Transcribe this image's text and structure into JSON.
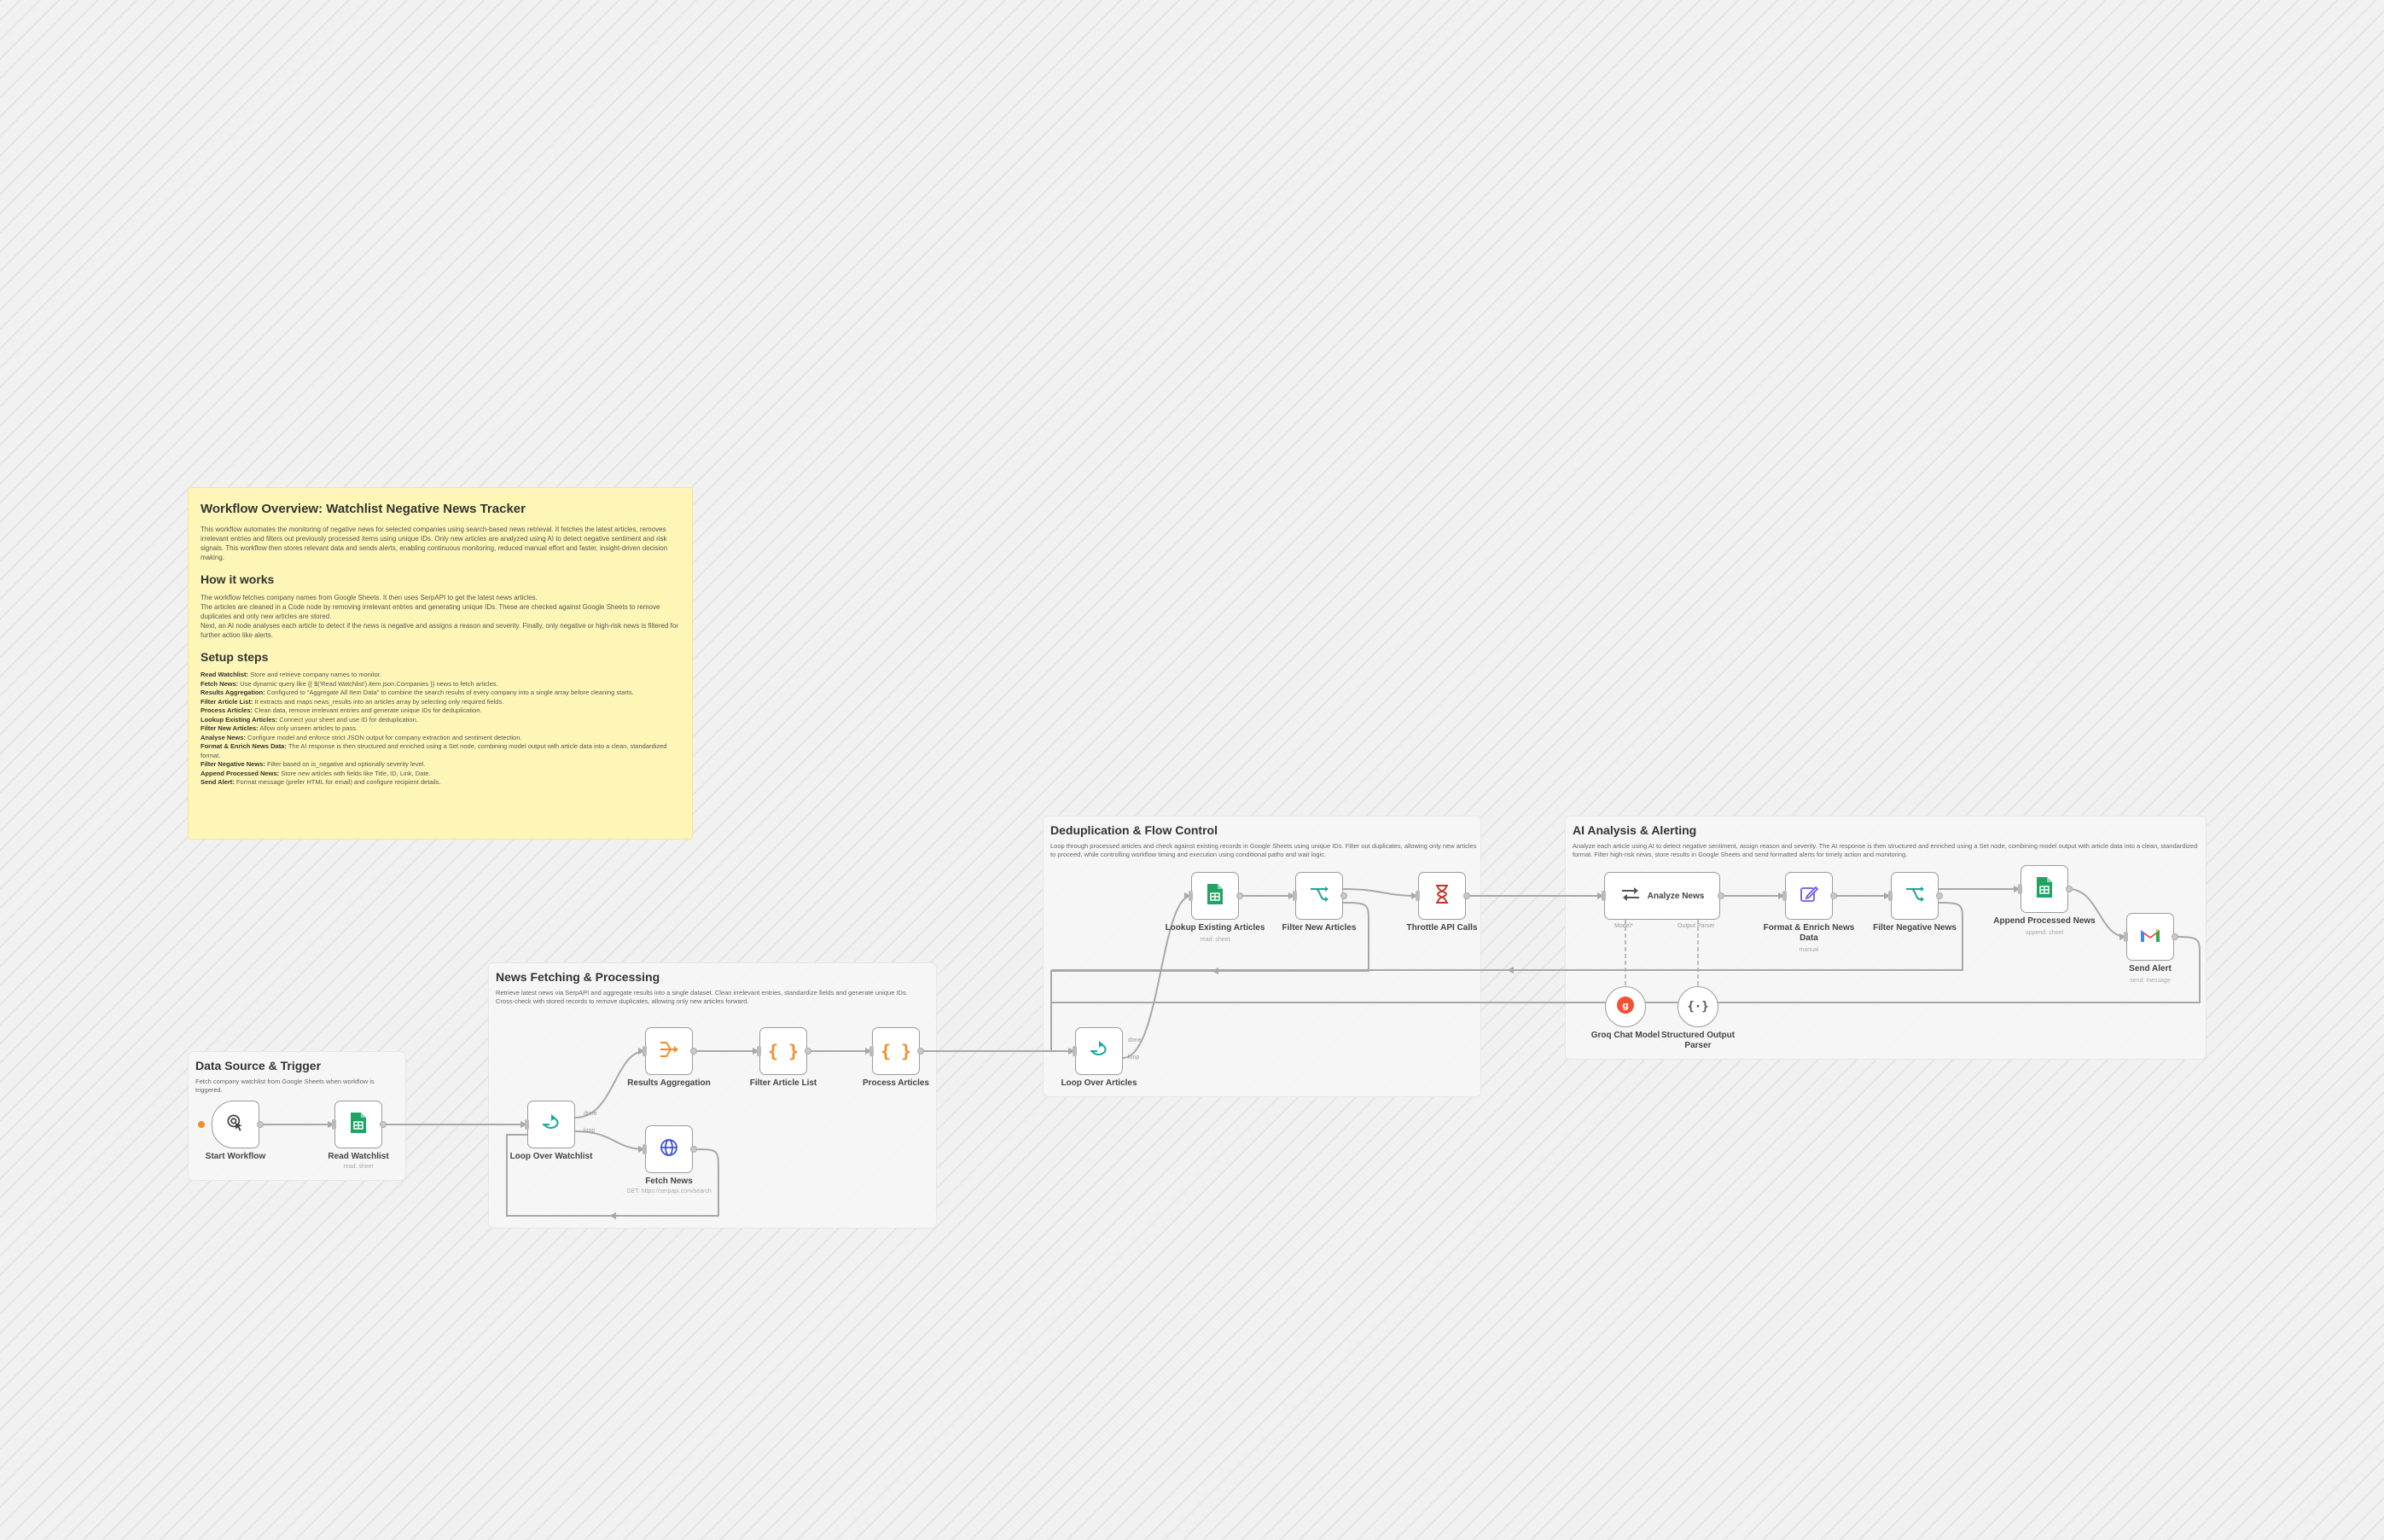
{
  "overview": {
    "title": "Workflow Overview: Watchlist Negative News Tracker",
    "intro": "This workflow automates the monitoring of negative news for selected companies using search-based news retrieval. It fetches the latest articles, removes irrelevant entries and filters out previously processed items using unique IDs. Only new articles are analyzed using AI to detect negative sentiment and risk signals. This workflow then stores relevant data and sends alerts, enabling continuous monitoring, reduced manual effort and faster, insight-driven decision making.",
    "how_title": "How it works",
    "how_1": "The workflow fetches company names from Google Sheets. It then uses SerpAPI to get the latest news articles.",
    "how_2": "The articles are cleaned in a Code node by removing irrelevant entries and generating unique IDs. These are checked against Google Sheets to remove duplicates and only new articles are stored.",
    "how_3": "Next, an AI node analyses each article to detect if the news is negative and assigns a reason and severity. Finally, only negative or high-risk news is filtered for further action like alerts.",
    "setup_title": "Setup steps",
    "steps": [
      {
        "name": "Read Watchlist:",
        "text": "Store and retrieve company names to monitor."
      },
      {
        "name": "Fetch News:",
        "text": "Use dynamic query like {{ $('Read Watchlist').item.json.Companies }} news to fetch articles."
      },
      {
        "name": "Results Aggregation:",
        "text": "Configured to \"Aggregate All Item Data\" to combine the search results of every company into a single array before cleaning starts."
      },
      {
        "name": "Filter Article List:",
        "text": "It extracts and maps news_results into an articles array by selecting only required fields."
      },
      {
        "name": "Process Articles:",
        "text": "Clean data, remove irrelevant entries and generate unique IDs for deduplication."
      },
      {
        "name": "Lookup Existing Articles:",
        "text": "Connect your sheet and use ID for deduplication."
      },
      {
        "name": "Filter New Articles:",
        "text": "Allow only unseen articles to pass."
      },
      {
        "name": "Analyse News:",
        "text": "Configure model and enforce strict JSON output for company extraction and sentiment detection."
      },
      {
        "name": "Format & Enrich News Data:",
        "text": "The AI response is then structured and enriched using a Set node, combining model output with article data into a clean, standardized format."
      },
      {
        "name": "Filter Negative News:",
        "text": "Filter based on is_negative and optionally severity level."
      },
      {
        "name": "Append Processed News:",
        "text": "Store new articles with fields like Title, ID, Link, Date."
      },
      {
        "name": "Send Alert:",
        "text": "Format message (prefer HTML for email) and configure recipient details."
      }
    ]
  },
  "groups": {
    "data_source": {
      "title": "Data Source & Trigger",
      "desc": "Fetch company watchlist from Google Sheets when workflow is triggered."
    },
    "news": {
      "title": "News Fetching & Processing",
      "desc": "Retrieve latest news via SerpAPI and aggregate results into a single dataset. Clean irrelevant entries, standardize fields and generate unique IDs. Cross-check with stored records to remove duplicates, allowing only new articles forward."
    },
    "dedup": {
      "title": "Deduplication & Flow Control",
      "desc": "Loop through processed articles and check against existing records in Google Sheets using unique IDs. Filter out duplicates, allowing only new articles to proceed, while controlling workflow timing and execution using conditional paths and wait logic."
    },
    "ai": {
      "title": "AI Analysis & Alerting",
      "desc": "Analyze each article using AI to detect negative sentiment, assign reason and severity. The AI response is then structured and enriched using a Set node, combining model output with article data into a clean, standardized format. Filter high-risk news, store results in Google Sheets and send formatted alerts for timely action and monitoring."
    }
  },
  "nodes": {
    "start": {
      "label": "Start Workflow"
    },
    "read_watchlist": {
      "label": "Read Watchlist",
      "sub": "read: sheet"
    },
    "loop_watchlist": {
      "label": "Loop Over Watchlist",
      "port_top": "done",
      "port_bottom": "loop"
    },
    "results_agg": {
      "label": "Results Aggregation"
    },
    "filter_list": {
      "label": "Filter Article List"
    },
    "process": {
      "label": "Process Articles"
    },
    "fetch": {
      "label": "Fetch News",
      "sub": "GET: https://serpapi.com/search"
    },
    "loop_articles": {
      "label": "Loop Over Articles",
      "port_top": "done",
      "port_bottom": "loop"
    },
    "lookup": {
      "label": "Lookup Existing Articles",
      "sub": "read: sheet"
    },
    "filter_new": {
      "label": "Filter New Articles"
    },
    "throttle": {
      "label": "Throttle API Calls"
    },
    "analyze": {
      "label": "Analyze News",
      "port_model": "Model*",
      "port_parser": "Output Parser"
    },
    "format": {
      "label": "Format & Enrich News Data",
      "sub": "manual"
    },
    "filter_neg": {
      "label": "Filter Negative News"
    },
    "append": {
      "label": "Append Processed News",
      "sub": "append: sheet"
    },
    "send": {
      "label": "Send Alert",
      "sub": "send: message"
    },
    "groq": {
      "label": "Groq Chat Model"
    },
    "parser": {
      "label": "Structured Output Parser"
    }
  },
  "icons": {
    "start": "cursor-click-icon",
    "sheets": "google-sheets-icon",
    "loop": "loop-icon",
    "aggregate": "aggregate-icon",
    "code": "code-braces-icon",
    "http": "globe-icon",
    "filter": "filter-branch-icon",
    "wait": "hourglass-icon",
    "ai": "ai-agent-icon",
    "edit": "edit-icon",
    "gmail": "gmail-icon",
    "groq": "groq-icon",
    "parser": "json-braces-icon"
  },
  "colors": {
    "sticky": "#fdf6b6",
    "sheets_green": "#1fa463",
    "code_orange": "#f28c28",
    "filter_teal": "#19a89c",
    "http_blue": "#3f51d8",
    "wait_red": "#c0392b",
    "edit_purple": "#6c5ce7",
    "groq_red": "#f55036"
  }
}
